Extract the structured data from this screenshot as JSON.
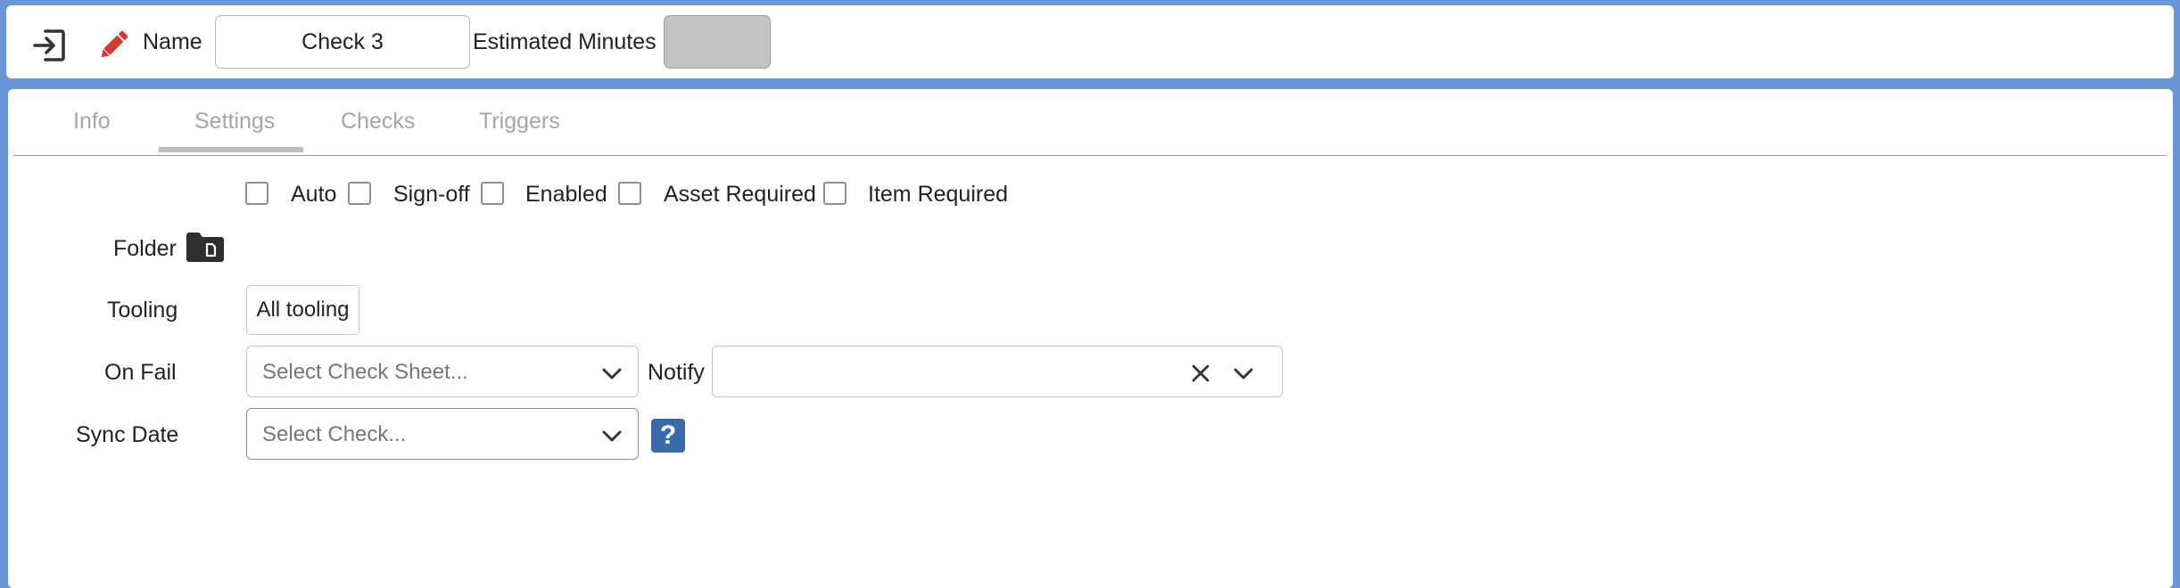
{
  "header": {
    "exit_icon": "exit-icon",
    "edit_icon": "pencil-icon",
    "name_label": "Name",
    "name_value": "Check 3",
    "estimated_minutes_label": "Estimated Minutes",
    "estimated_minutes_value": ""
  },
  "tabs": [
    {
      "label": "Info",
      "active": false
    },
    {
      "label": "Settings",
      "active": true
    },
    {
      "label": "Checks",
      "active": false
    },
    {
      "label": "Triggers",
      "active": false
    }
  ],
  "settings": {
    "checkboxes": [
      {
        "label": "Auto",
        "checked": false
      },
      {
        "label": "Sign-off",
        "checked": false
      },
      {
        "label": "Enabled",
        "checked": false
      },
      {
        "label": "Asset Required",
        "checked": false
      },
      {
        "label": "Item Required",
        "checked": false
      }
    ],
    "folder_label": "Folder",
    "folder_icon": "folder-icon",
    "tooling_label": "Tooling",
    "tooling_value": "All tooling",
    "on_fail_label": "On Fail",
    "on_fail_placeholder": "Select Check Sheet...",
    "notify_label": "Notify",
    "notify_value": "",
    "sync_date_label": "Sync Date",
    "sync_date_placeholder": "Select Check...",
    "help_glyph": "?"
  },
  "colors": {
    "background": "#6b96d6",
    "edit_icon": "#d03b32",
    "help_button": "#3b6aa8",
    "estimated_minutes_field": "#c2c2c2"
  }
}
